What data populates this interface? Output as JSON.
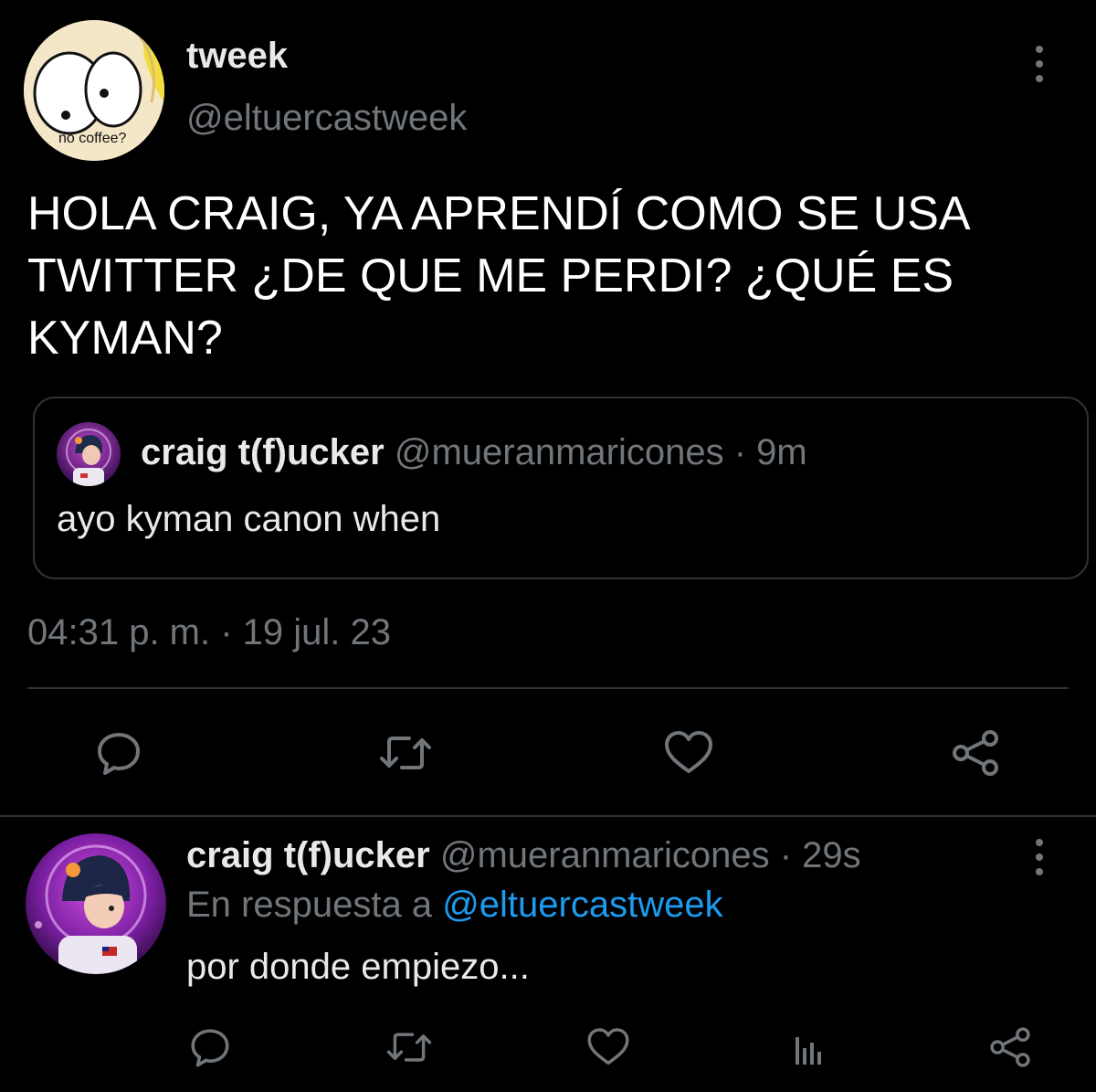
{
  "main_tweet": {
    "author_name": "tweek",
    "author_handle": "@eltuercastweek",
    "avatar_caption": "no coffee?",
    "text_lines": [
      "HOLA CRAIG, YA APRENDÍ COMO SE USA",
      "TWITTER ¿DE QUE ME PERDI? ¿QUÉ ES",
      "KYMAN?"
    ],
    "timestamp": "04:31 p. m. · 19 jul. 23",
    "more_icon": "more-vertical-icon"
  },
  "quoted_tweet": {
    "author_name": "craig t(f)ucker",
    "author_meta": "@mueranmaricones · 9m",
    "text": "ayo kyman canon when"
  },
  "main_actions": [
    {
      "name": "reply",
      "icon": "comment-icon"
    },
    {
      "name": "retweet",
      "icon": "retweet-icon"
    },
    {
      "name": "like",
      "icon": "heart-icon"
    },
    {
      "name": "share",
      "icon": "share-icon"
    }
  ],
  "reply_tweet": {
    "author_name": "craig t(f)ucker",
    "author_meta": "@mueranmaricones · 29s",
    "replying_to_prefix": "En respuesta a",
    "replying_to_handle": "@eltuercastweek",
    "text": "por donde empiezo...",
    "more_icon": "more-vertical-icon"
  },
  "reply_actions": [
    {
      "name": "reply",
      "icon": "comment-icon"
    },
    {
      "name": "retweet",
      "icon": "retweet-icon"
    },
    {
      "name": "like",
      "icon": "heart-icon"
    },
    {
      "name": "views",
      "icon": "analytics-icon"
    },
    {
      "name": "share",
      "icon": "share-icon"
    }
  ],
  "colors": {
    "background": "#000000",
    "primary_text": "#e7e9ea",
    "secondary_text": "#71767b",
    "border": "#2f3336",
    "link": "#1d9bf0"
  }
}
